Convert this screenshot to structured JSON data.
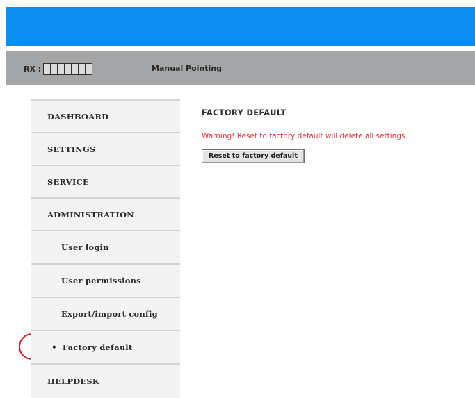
{
  "header": {
    "rx_label": "RX :",
    "rx_boxes_count": 7,
    "mode_label": "Manual Pointing"
  },
  "sidebar": {
    "items": [
      {
        "label": "DASHBOARD",
        "level": "top"
      },
      {
        "label": "SETTINGS",
        "level": "top"
      },
      {
        "label": "SERVICE",
        "level": "top"
      },
      {
        "label": "ADMINISTRATION",
        "level": "top"
      },
      {
        "label": "User login",
        "level": "sub"
      },
      {
        "label": "User permissions",
        "level": "sub"
      },
      {
        "label": "Export/import config",
        "level": "sub"
      },
      {
        "label": "Factory default",
        "level": "sub",
        "active": true
      },
      {
        "label": "HELPDESK",
        "level": "top"
      }
    ]
  },
  "main": {
    "title": "FACTORY DEFAULT",
    "warning": "Warning! Reset to factory default will delete all settings.",
    "reset_button_label": "Reset to factory default"
  },
  "colors": {
    "banner": "#0a8ff0",
    "status_bar": "#a3a5a7",
    "warning": "#e8353a",
    "highlight": "#d61f26"
  }
}
